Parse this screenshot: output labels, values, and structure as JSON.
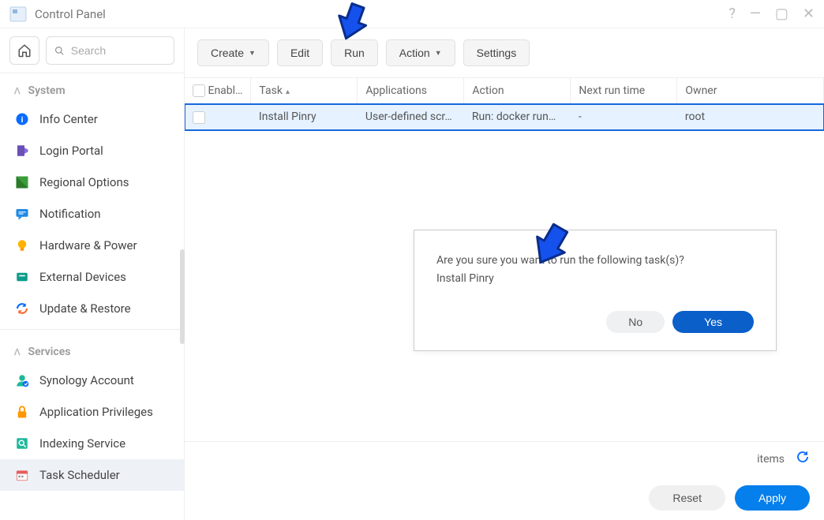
{
  "window": {
    "title": "Control Panel"
  },
  "search": {
    "placeholder": "Search"
  },
  "sections": {
    "system": {
      "label": "System",
      "items": [
        {
          "label": "Info Center"
        },
        {
          "label": "Login Portal"
        },
        {
          "label": "Regional Options"
        },
        {
          "label": "Notification"
        },
        {
          "label": "Hardware & Power"
        },
        {
          "label": "External Devices"
        },
        {
          "label": "Update & Restore"
        }
      ]
    },
    "services": {
      "label": "Services",
      "items": [
        {
          "label": "Synology Account"
        },
        {
          "label": "Application Privileges"
        },
        {
          "label": "Indexing Service"
        },
        {
          "label": "Task Scheduler"
        }
      ]
    }
  },
  "toolbar": {
    "create": "Create",
    "edit": "Edit",
    "run": "Run",
    "action": "Action",
    "settings": "Settings"
  },
  "table": {
    "headers": {
      "enabled": "Enabl…",
      "task": "Task",
      "applications": "Applications",
      "action": "Action",
      "next_run": "Next run time",
      "owner": "Owner"
    },
    "rows": [
      {
        "task": "Install Pinry",
        "applications": "User-defined scr…",
        "action": "Run: docker run…",
        "next_run": "-",
        "owner": "root"
      }
    ]
  },
  "dialog": {
    "line1": "Are you sure you want to run the following task(s)?",
    "line2": "Install Pinry",
    "no": "No",
    "yes": "Yes"
  },
  "statusbar": {
    "items": "items"
  },
  "footer": {
    "reset": "Reset",
    "apply": "Apply"
  }
}
